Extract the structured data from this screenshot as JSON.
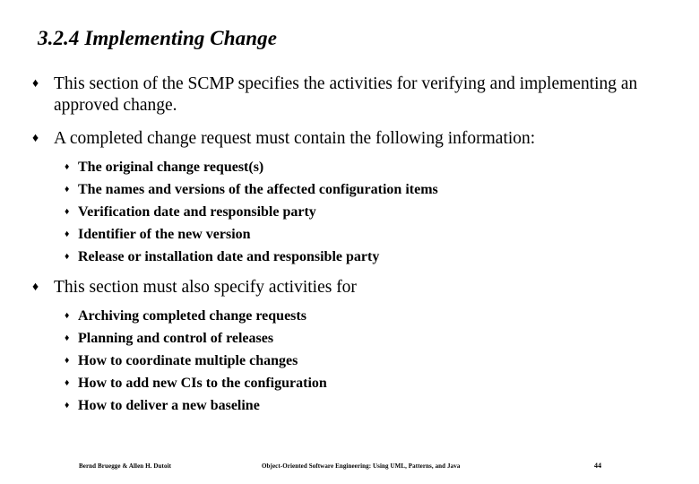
{
  "slide": {
    "title": "3.2.4 Implementing Change",
    "background_color": "#ffffff",
    "text_color": "#000000",
    "bullet_glyph_level1": "♦",
    "bullet_glyph_level2": "♦",
    "blocks": [
      {
        "level1": "This section of the SCMP specifies the activities for verifying and implementing an approved change.",
        "sublist": []
      },
      {
        "level1": "A completed change request must contain the following information:",
        "sublist": [
          "The original change request(s)",
          "The names and versions of the affected configuration items",
          "Verification date and responsible party",
          "Identifier of the new version",
          "Release or installation date and responsible party"
        ]
      },
      {
        "level1": "This section must also specify activities for",
        "sublist": [
          "Archiving completed change requests",
          "Planning and control of releases",
          "How to coordinate multiple changes",
          "How to add new CIs to the configuration",
          "How to deliver a new baseline"
        ]
      }
    ]
  },
  "footer": {
    "authors": "Bernd Bruegge & Allen H. Dutoit",
    "book_title": "Object-Oriented Software Engineering: Using UML, Patterns, and Java",
    "page_number": "44"
  }
}
